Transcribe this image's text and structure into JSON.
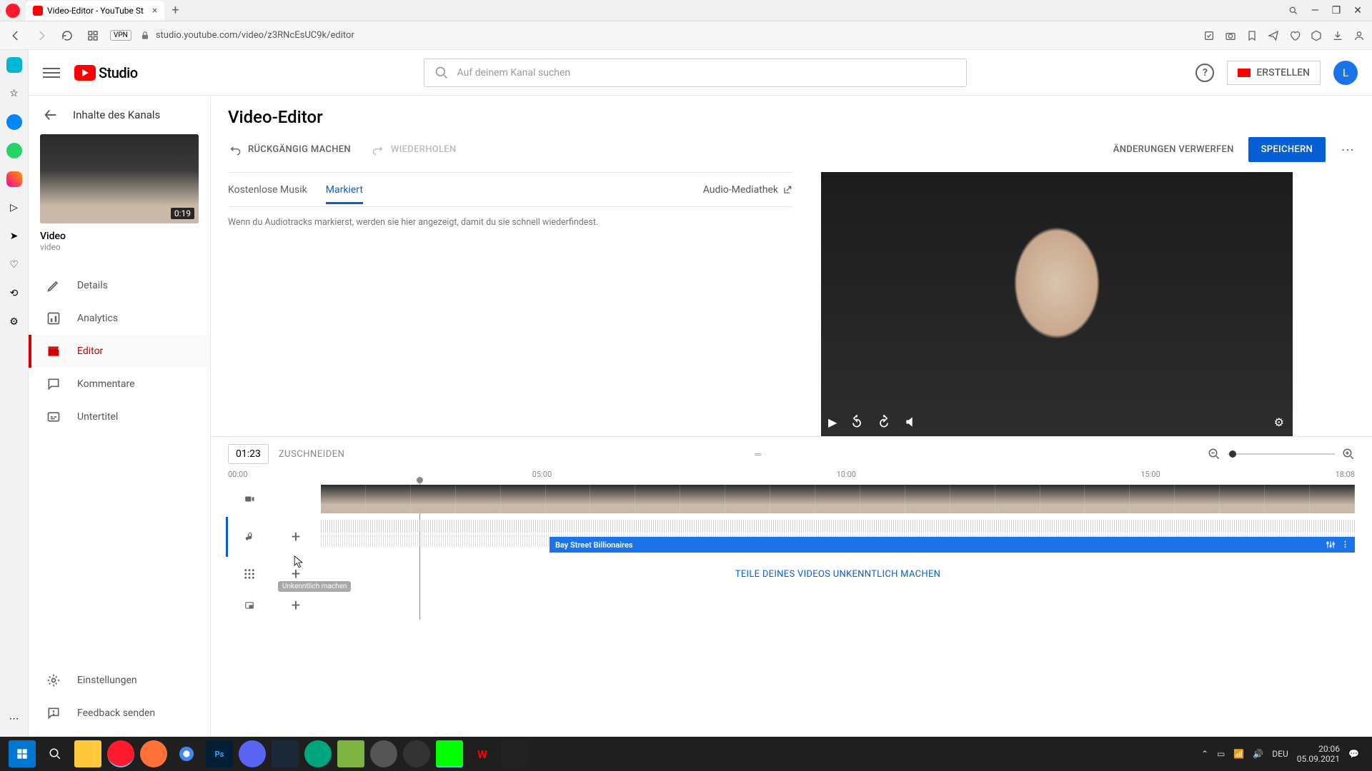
{
  "browser": {
    "tab_title": "Video-Editor - YouTube St",
    "url": "studio.youtube.com/video/z3RNcEsUC9k/editor",
    "vpn": "VPN"
  },
  "header": {
    "logo_text": "Studio",
    "search_placeholder": "Auf deinem Kanal suchen",
    "create_label": "ERSTELLEN",
    "avatar_letter": "L"
  },
  "leftnav": {
    "back_label": "Inhalte des Kanals",
    "thumb_duration": "0:19",
    "video_title": "Video",
    "video_sub": "video",
    "items": [
      {
        "label": "Details",
        "icon": "pencil"
      },
      {
        "label": "Analytics",
        "icon": "chart"
      },
      {
        "label": "Editor",
        "icon": "clapper"
      },
      {
        "label": "Kommentare",
        "icon": "comment"
      },
      {
        "label": "Untertitel",
        "icon": "subtitles"
      }
    ],
    "bottom": [
      {
        "label": "Einstellungen",
        "icon": "gear"
      },
      {
        "label": "Feedback senden",
        "icon": "feedback"
      }
    ]
  },
  "editor": {
    "title": "Video-Editor",
    "undo": "RÜCKGÄNGIG MACHEN",
    "redo": "WIEDERHOLEN",
    "discard": "ÄNDERUNGEN VERWERFEN",
    "save": "SPEICHERN",
    "tabs": {
      "free": "Kostenlose Musik",
      "starred": "Markiert"
    },
    "audio_library": "Audio-Mediathek",
    "hint_text": "Wenn du Audiotracks markierst, werden sie hier angezeigt, damit du sie schnell wiederfindest."
  },
  "timeline": {
    "current_time": "01:23",
    "trim": "ZUSCHNEIDEN",
    "markers": {
      "m0": "00:00",
      "m1": "05:00",
      "m2": "10:00",
      "m3": "15:00",
      "m4": "18:08"
    },
    "audio_clip_name": "Bay Street Billionaires",
    "blur_cta": "TEILE DEINES VIDEOS UNKENNTLICH MACHEN",
    "tooltip": "Unkenntlich machen"
  },
  "taskbar": {
    "time": "20:06",
    "date": "05.09.2021"
  }
}
